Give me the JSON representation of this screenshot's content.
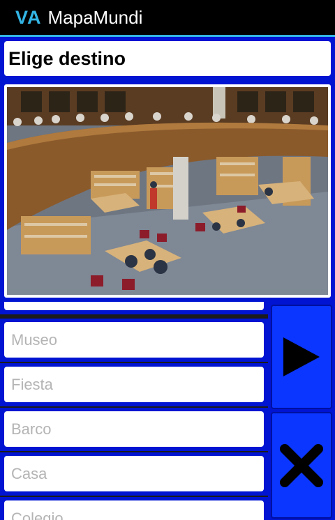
{
  "app": {
    "logo": "VA",
    "title": "MapaMundi"
  },
  "header": {
    "title": "Elige destino"
  },
  "image": {
    "description_icon": "library-photo"
  },
  "list": {
    "items": [
      {
        "placeholder": ""
      },
      {
        "placeholder": "Museo"
      },
      {
        "placeholder": "Fiesta"
      },
      {
        "placeholder": "Barco"
      },
      {
        "placeholder": "Casa"
      },
      {
        "placeholder": "Colegio"
      }
    ]
  },
  "buttons": {
    "play_icon": "play-icon",
    "close_icon": "close-icon"
  },
  "colors": {
    "panel": "#0014d2",
    "accent": "#33b5e5",
    "button": "#0a36ff"
  }
}
